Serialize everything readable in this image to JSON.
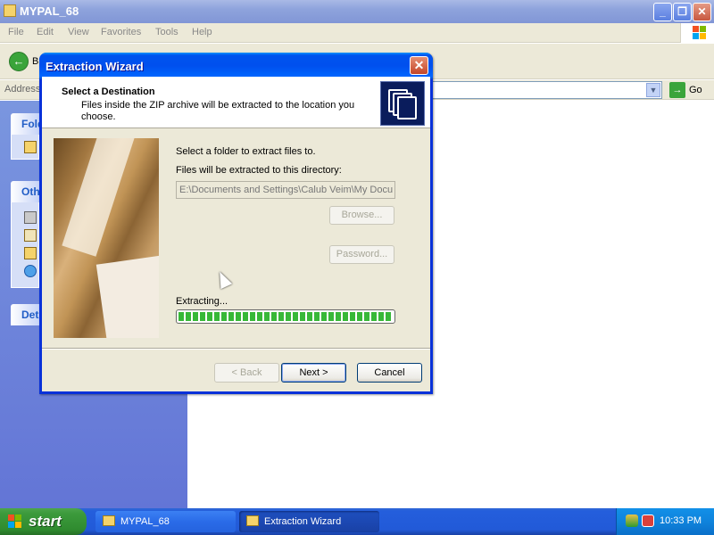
{
  "explorer": {
    "title": "MYPAL_68",
    "menu": [
      "File",
      "Edit",
      "View",
      "Favorites",
      "Tools",
      "Help"
    ],
    "toolbar": {
      "back_label": "B"
    },
    "address": {
      "label": "Address",
      "go_label": "Go"
    },
    "taskpane": {
      "folder_head": "Fold",
      "other_head": "Oth",
      "details_head": "Det"
    }
  },
  "wizard": {
    "title": "Extraction Wizard",
    "header_title": "Select a Destination",
    "header_subtitle": "Files inside the ZIP archive will be extracted to the location you choose.",
    "prompt": "Select a folder to extract files to.",
    "dir_label": "Files will be extracted to this directory:",
    "path_value": "E:\\Documents and Settings\\Calub Veim\\My Docu",
    "browse_label": "Browse...",
    "password_label": "Password...",
    "status_label": "Extracting...",
    "progress": 1.0,
    "back_label": "< Back",
    "next_label": "Next >",
    "cancel_label": "Cancel"
  },
  "taskbar": {
    "start_label": "start",
    "tasks": [
      {
        "label": "MYPAL_68"
      },
      {
        "label": "Extraction Wizard"
      }
    ],
    "clock": "10:33 PM"
  }
}
